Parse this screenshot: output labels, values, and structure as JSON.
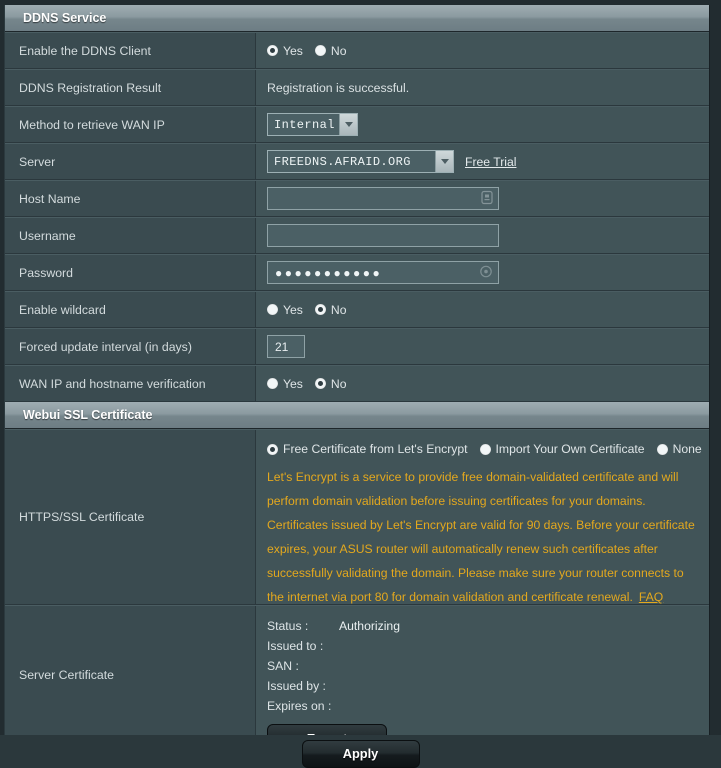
{
  "sections": {
    "ddns": {
      "title": "DDNS Service",
      "rows": {
        "enable_client": {
          "label": "Enable the DDNS Client",
          "options": [
            "Yes",
            "No"
          ],
          "selected": "Yes"
        },
        "registration_result": {
          "label": "DDNS Registration Result",
          "value": "Registration is successful."
        },
        "method": {
          "label": "Method to retrieve WAN IP",
          "value": "Internal"
        },
        "server": {
          "label": "Server",
          "value": "FREEDNS.AFRAID.ORG",
          "link_label": "Free Trial"
        },
        "host_name": {
          "label": "Host Name",
          "value": "",
          "placeholder": "",
          "icon": "id-card-icon"
        },
        "username": {
          "label": "Username",
          "value": "",
          "placeholder": ""
        },
        "password": {
          "label": "Password",
          "value": "●●●●●●●●●●●",
          "icon": "eye-icon"
        },
        "wildcard": {
          "label": "Enable wildcard",
          "options": [
            "Yes",
            "No"
          ],
          "selected": "No"
        },
        "forced_update": {
          "label": "Forced update interval (in days)",
          "value": "21"
        },
        "wanip_verification": {
          "label": "WAN IP and hostname verification",
          "options": [
            "Yes",
            "No"
          ],
          "selected": "No"
        }
      }
    },
    "ssl": {
      "title": "Webui SSL Certificate",
      "https_cert": {
        "label": "HTTPS/SSL Certificate",
        "options": [
          "Free Certificate from Let's Encrypt",
          "Import Your Own Certificate",
          "None"
        ],
        "selected": "Free Certificate from Let's Encrypt",
        "description": "Let's Encrypt is a service to provide free domain-validated certificate and will perform domain validation before issuing certificates for your domains. Certificates issued by Let's Encrypt are valid for 90 days. Before your certificate expires, your ASUS router will automatically renew such certificates after successfully validating the domain. Please make sure your router connects to the internet via port 80 for domain validation and certificate renewal.",
        "faq_label": "FAQ"
      },
      "server_cert": {
        "label": "Server Certificate",
        "fields": [
          {
            "key": "Status :",
            "value": "Authorizing"
          },
          {
            "key": "Issued to :",
            "value": ""
          },
          {
            "key": "SAN :",
            "value": ""
          },
          {
            "key": "Issued by :",
            "value": ""
          },
          {
            "key": "Expires on :",
            "value": ""
          }
        ],
        "export_label": "Export"
      }
    }
  },
  "footer": {
    "apply_label": "Apply"
  },
  "colors": {
    "panel_bg": "#3e5055",
    "row_label_bg": "#3a4b50",
    "row_value_bg": "#415458",
    "accent_orange": "#e3a81e",
    "header_gradient_top": "#9fadb2"
  }
}
